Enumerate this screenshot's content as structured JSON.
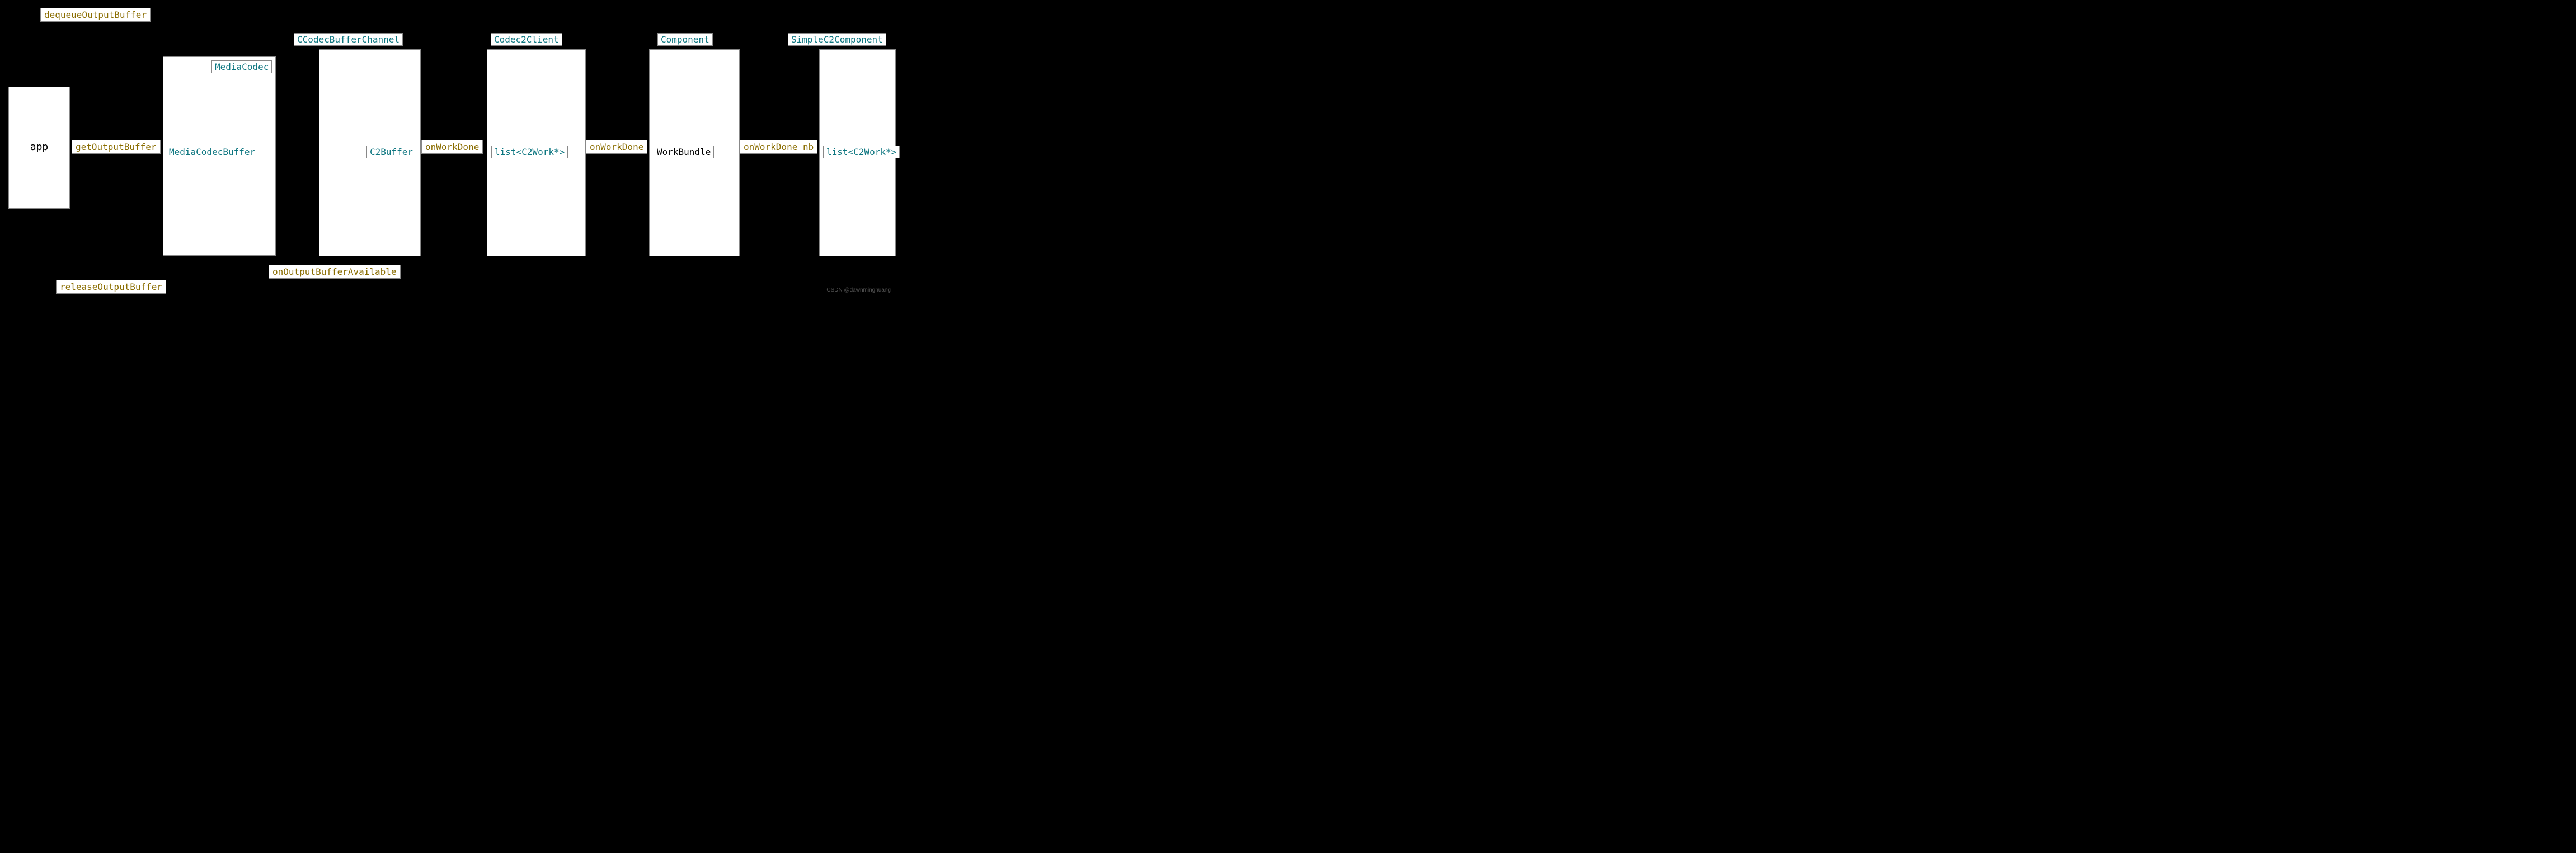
{
  "labels": {
    "dequeueOutputBuffer": "dequeueOutputBuffer",
    "releaseOutputBuffer": "releaseOutputBuffer",
    "onOutputBufferAvailable": "onOutputBufferAvailable",
    "getOutputBuffer": "getOutputBuffer",
    "onWorkDone1": "onWorkDone",
    "onWorkDone2": "onWorkDone",
    "onWorkDone_nb": "onWorkDone_nb"
  },
  "nodes": {
    "app": "app",
    "MediaCodec": "MediaCodec",
    "MediaCodecBuffer": "MediaCodecBuffer",
    "CCodecBufferChannel": "CCodecBufferChannel",
    "C2Buffer": "C2Buffer",
    "Codec2Client": "Codec2Client",
    "listC2Work1": "list<C2Work*>",
    "Component": "Component",
    "WorkBundle": "WorkBundle",
    "SimpleC2Component": "SimpleC2Component",
    "listC2Work2": "list<C2Work*>"
  },
  "watermark": "CSDN @dawnminghuang"
}
